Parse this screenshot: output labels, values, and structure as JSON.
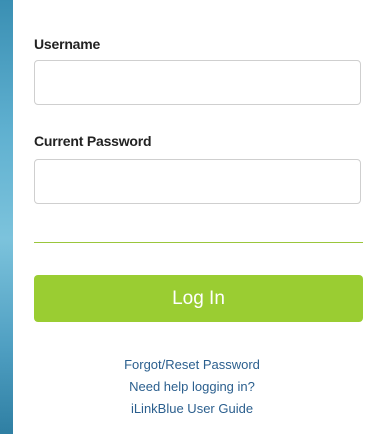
{
  "login_form": {
    "username_label": "Username",
    "username_value": "",
    "password_label": "Current Password",
    "password_value": "",
    "login_button_label": "Log In"
  },
  "help_links": [
    "Forgot/Reset Password",
    "Need help logging in?",
    "iLinkBlue User Guide"
  ],
  "colors": {
    "accent": "#9acd32",
    "link": "#2b5f8e",
    "background": "#5fb0d0"
  }
}
